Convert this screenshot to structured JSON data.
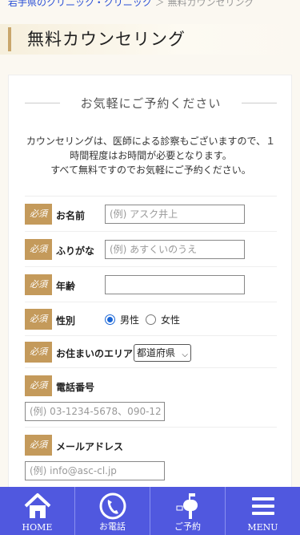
{
  "breadcrumb": {
    "link": "岩手県のクリニック・クリニック",
    "separator": "＞",
    "current": "無料カウンセリング"
  },
  "page_title": "無料カウンセリング",
  "form": {
    "heading": "お気軽にご予約ください",
    "intro_lines": [
      "カウンセリングは、医師による診察もございますので、１",
      "時間程度はお時間が必要となります。",
      "すべて無料ですのでお気軽にご予約ください。"
    ],
    "required_badge": "必須",
    "fields": {
      "name": {
        "label": "お名前",
        "placeholder": "(例) アスク井上"
      },
      "furigana": {
        "label": "ふりがな",
        "placeholder": "(例) あすくいのうえ"
      },
      "age": {
        "label": "年齢",
        "placeholder": ""
      },
      "gender": {
        "label": "性別",
        "options": [
          "男性",
          "女性"
        ],
        "selected": "男性"
      },
      "area": {
        "label": "お住まいのエリア",
        "selected": "都道府県"
      },
      "phone": {
        "label": "電話番号",
        "placeholder": "(例) 03-1234-5678、090-12"
      },
      "email": {
        "label": "メールアドレス",
        "placeholder": "(例) info@asc-cl.jp"
      }
    }
  },
  "bottom_nav": [
    {
      "label": "HOME",
      "icon": "home-icon"
    },
    {
      "label": "お電話",
      "icon": "phone-icon"
    },
    {
      "label": "ご予約",
      "icon": "mailbox-icon"
    },
    {
      "label": "MENU",
      "icon": "menu-icon"
    }
  ],
  "colors": {
    "accent": "#c49a5b",
    "nav": "#5058df",
    "link": "#2a4fd6"
  }
}
